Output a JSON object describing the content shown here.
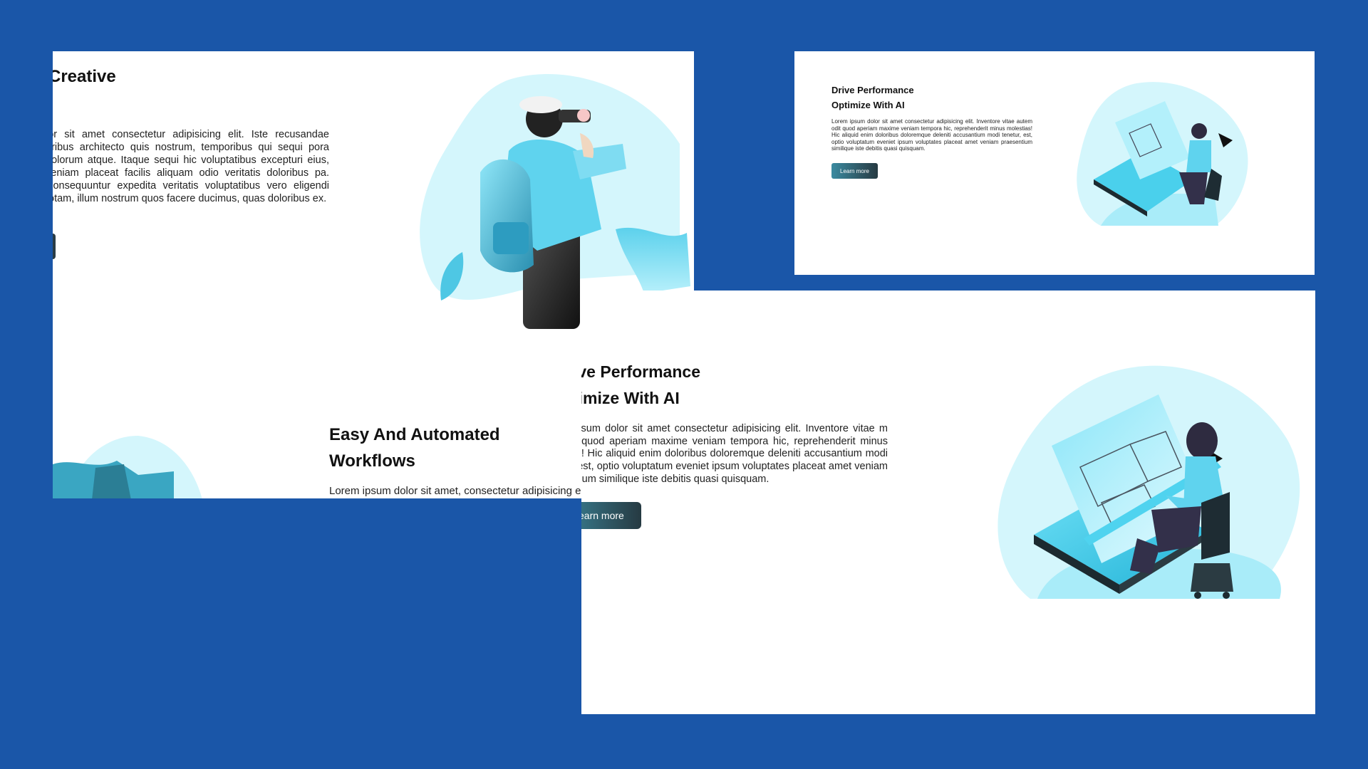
{
  "colors": {
    "background": "#1a56a8",
    "panel": "#ffffff",
    "blob_light": "#d4f6fc",
    "blob_accent": "#7fe0f5",
    "button_dark": "#263a42",
    "button_light": "#3b8ba1"
  },
  "left_panel": {
    "title": "Creative",
    "body": "lor sit amet consectetur adipisicing elit. Iste recusandae oribus architecto quis nostrum, temporibus qui sequi pora dolorum atque. Itaque sequi hic voluptatibus excepturi eius, veniam placeat facilis aliquam odio veritatis doloribus pa. Consequuntur expedita veritatis voluptatibus vero eligendi totam, illum nostrum quos facere ducimus, quas doloribus ex.",
    "second_title": "Easy And Automated Workflows",
    "second_body": "Lorem ipsum dolor sit amet, consectetur adipisicing el",
    "illustration_icon": "hiker-binoculars-illustration",
    "bottom_illustration_icon": "blob-rocks-illustration"
  },
  "top_right_panel": {
    "title_line1": "Drive Performance",
    "title_line2": "Optimize With AI",
    "body": "Lorem ipsum dolor sit amet consectetur adipisicing elit. Inventore vitae autem odit quod aperiam maxime veniam tempora hic, reprehenderit minus molestias! Hic aliquid enim doloribus doloremque deleniti accusantium modi tenetur, est, optio voluptatum eveniet ipsum voluptates placeat amet veniam praesentium similique iste debitis quasi quisquam.",
    "button_label": "Learn more",
    "illustration_icon": "designer-at-drafting-table-illustration"
  },
  "main_panel": {
    "title_line1": "ive Performance",
    "title_line2": "timize With AI",
    "body": "m ipsum dolor sit amet consectetur adipisicing elit. Inventore vitae m odit quod aperiam maxime veniam tempora hic, reprehenderit minus stias! Hic aliquid enim doloribus doloremque deleniti accusantium modi tur, est, optio voluptatum eveniet ipsum voluptates placeat amet veniam sentium similique iste debitis quasi quisquam.",
    "button_label": "earn more",
    "illustration_icon": "designer-at-drafting-table-illustration"
  }
}
